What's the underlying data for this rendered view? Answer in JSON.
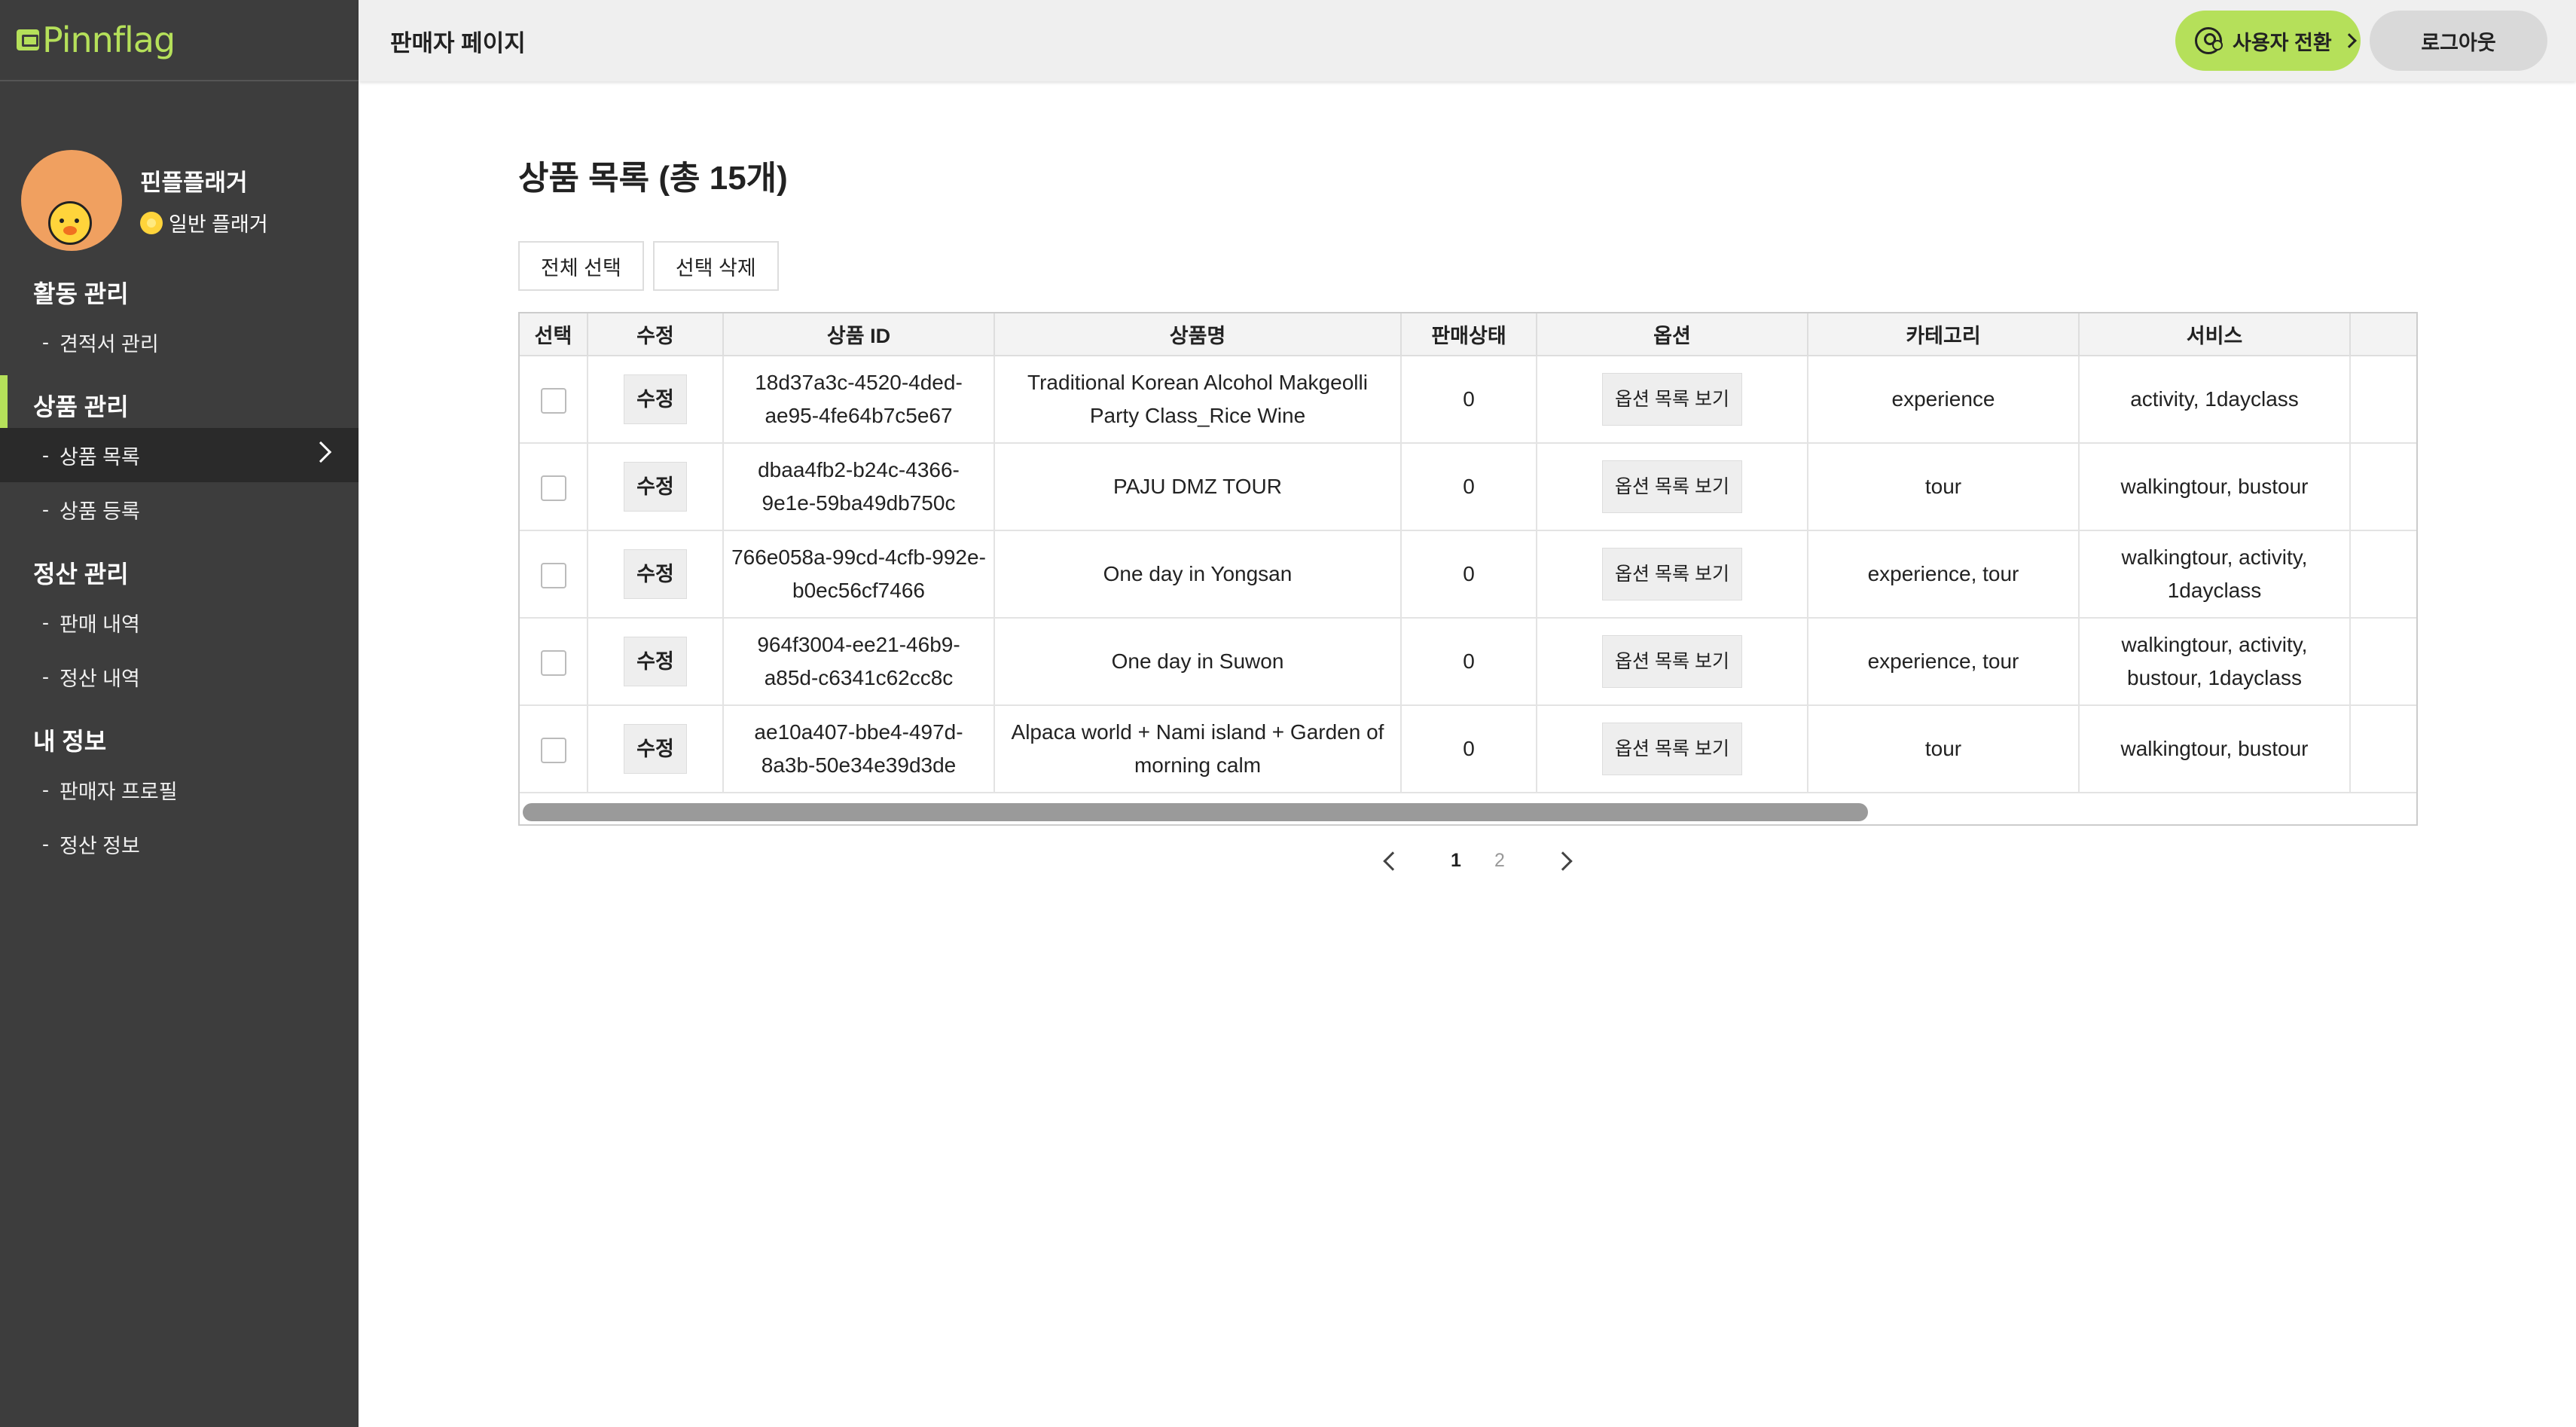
{
  "logo": {
    "text": "Pinnflag"
  },
  "profile": {
    "name": "핀플플래거",
    "level": "일반 플래거"
  },
  "nav": {
    "sections": [
      {
        "label": "활동 관리",
        "items": [
          {
            "label": "견적서 관리"
          }
        ]
      },
      {
        "label": "상품 관리",
        "items": [
          {
            "label": "상품 목록"
          },
          {
            "label": "상품 등록"
          }
        ]
      },
      {
        "label": "정산 관리",
        "items": [
          {
            "label": "판매 내역"
          },
          {
            "label": "정산 내역"
          }
        ]
      },
      {
        "label": "내 정보",
        "items": [
          {
            "label": "판매자 프로필"
          },
          {
            "label": "정산 정보"
          }
        ]
      }
    ],
    "dash": "-"
  },
  "header": {
    "title": "판매자 페이지",
    "switch_label": "사용자 전환",
    "logout_label": "로그아웃"
  },
  "main": {
    "title": "상품 목록 (총 15개)",
    "select_all": "전체 선택",
    "delete_selected": "선택 삭제"
  },
  "table": {
    "columns": [
      "선택",
      "수정",
      "상품 ID",
      "상품명",
      "판매상태",
      "옵션",
      "카테고리",
      "서비스",
      ""
    ],
    "edit_label": "수정",
    "option_label": "옵션 목록 보기",
    "rows": [
      {
        "id": "18d37a3c-4520-4ded-ae95-4fe64b7c5e67",
        "name": "Traditional Korean Alcohol Makgeolli Party Class_Rice Wine",
        "status": "0",
        "category": "experience",
        "service": "activity, 1dayclass"
      },
      {
        "id": "dbaa4fb2-b24c-4366-9e1e-59ba49db750c",
        "name": "PAJU DMZ TOUR",
        "status": "0",
        "category": "tour",
        "service": "walkingtour, bustour"
      },
      {
        "id": "766e058a-99cd-4cfb-992e-b0ec56cf7466",
        "name": "One day in Yongsan",
        "status": "0",
        "category": "experience, tour",
        "service": "walkingtour, activity, 1dayclass"
      },
      {
        "id": "964f3004-ee21-46b9-a85d-c6341c62cc8c",
        "name": "One day in Suwon",
        "status": "0",
        "category": "experience, tour",
        "service": "walkingtour, activity, bustour, 1dayclass"
      },
      {
        "id": "ae10a407-bbe4-497d-8a3b-50e34e39d3de",
        "name": "Alpaca world + Nami island + Garden of morning calm",
        "status": "0",
        "category": "tour",
        "service": "walkingtour, bustour"
      }
    ]
  },
  "pagination": {
    "pages": [
      "1",
      "2"
    ],
    "current": "1"
  },
  "colors": {
    "accent": "#b5e05a",
    "sidebar": "#3d3d3d"
  }
}
